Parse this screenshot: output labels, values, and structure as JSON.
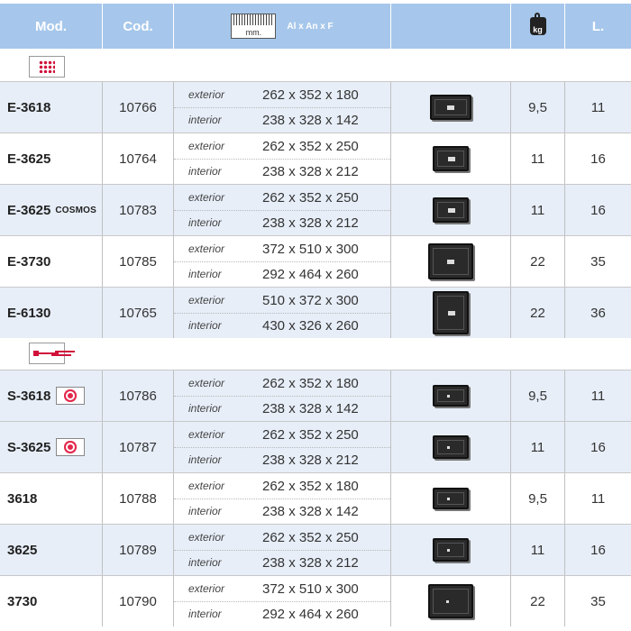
{
  "header": {
    "mod": "Mod.",
    "cod": "Cod.",
    "ruler_unit": "mm.",
    "dims": "Al x An x F",
    "weight_icon": "kg",
    "liters": "L."
  },
  "groups": [
    {
      "icon": "keypad-icon"
    },
    {
      "icon": "key-icon"
    }
  ],
  "rows": [
    {
      "mod": "E-3618",
      "sub": "",
      "cod": "10766",
      "ext_label": "exterior",
      "ext": "262 x 352 x 180",
      "int_label": "interior",
      "int": "238 x 328 x 142",
      "kg": "9,5",
      "l": "11"
    },
    {
      "mod": "E-3625",
      "sub": "",
      "cod": "10764",
      "ext_label": "exterior",
      "ext": "262 x 352 x 250",
      "int_label": "interior",
      "int": "238 x 328 x 212",
      "kg": "11",
      "l": "16"
    },
    {
      "mod": "E-3625",
      "sub": "COSMOS",
      "cod": "10783",
      "ext_label": "exterior",
      "ext": "262 x 352 x 250",
      "int_label": "interior",
      "int": "238 x 328 x 212",
      "kg": "11",
      "l": "16"
    },
    {
      "mod": "E-3730",
      "sub": "",
      "cod": "10785",
      "ext_label": "exterior",
      "ext": "372 x 510 x 300",
      "int_label": "interior",
      "int": "292 x 464 x 260",
      "kg": "22",
      "l": "35"
    },
    {
      "mod": "E-6130",
      "sub": "",
      "cod": "10765",
      "ext_label": "exterior",
      "ext": "510 x 372 x 300",
      "int_label": "interior",
      "int": "430 x 326 x 260",
      "kg": "22",
      "l": "36"
    },
    {
      "mod": "S-3618",
      "sub": "",
      "cod": "10786",
      "ext_label": "exterior",
      "ext": "262 x 352 x 180",
      "int_label": "interior",
      "int": "238 x 328 x 142",
      "kg": "9,5",
      "l": "11"
    },
    {
      "mod": "S-3625",
      "sub": "",
      "cod": "10787",
      "ext_label": "exterior",
      "ext": "262 x 352 x 250",
      "int_label": "interior",
      "int": "238 x 328 x 212",
      "kg": "11",
      "l": "16"
    },
    {
      "mod": "3618",
      "sub": "",
      "cod": "10788",
      "ext_label": "exterior",
      "ext": "262 x 352 x 180",
      "int_label": "interior",
      "int": "238 x 328 x 142",
      "kg": "9,5",
      "l": "11"
    },
    {
      "mod": "3625",
      "sub": "",
      "cod": "10789",
      "ext_label": "exterior",
      "ext": "262 x 352 x 250",
      "int_label": "interior",
      "int": "238 x 328 x 212",
      "kg": "11",
      "l": "16"
    },
    {
      "mod": "3730",
      "sub": "",
      "cod": "10790",
      "ext_label": "exterior",
      "ext": "372 x 510 x 300",
      "int_label": "interior",
      "int": "292 x 464 x 260",
      "kg": "22",
      "l": "35"
    }
  ]
}
